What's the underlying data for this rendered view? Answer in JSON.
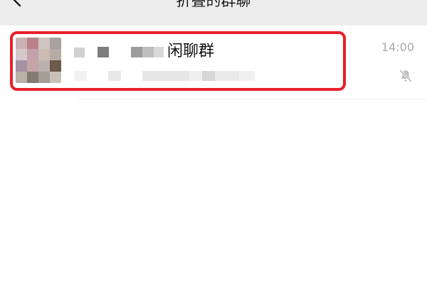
{
  "header": {
    "title": "折叠的群聊",
    "back_icon": "chevron-left-icon"
  },
  "chat": {
    "name_visible": "闲聊群",
    "time": "14:00",
    "status_icon": "bell-muted-icon",
    "name_obscured": true,
    "preview_obscured": true
  },
  "colors": {
    "nav_background": "#ededed",
    "highlight_border": "#e8202a",
    "time_text": "#a8a8a8",
    "icon_gray": "#c0c0c0"
  }
}
